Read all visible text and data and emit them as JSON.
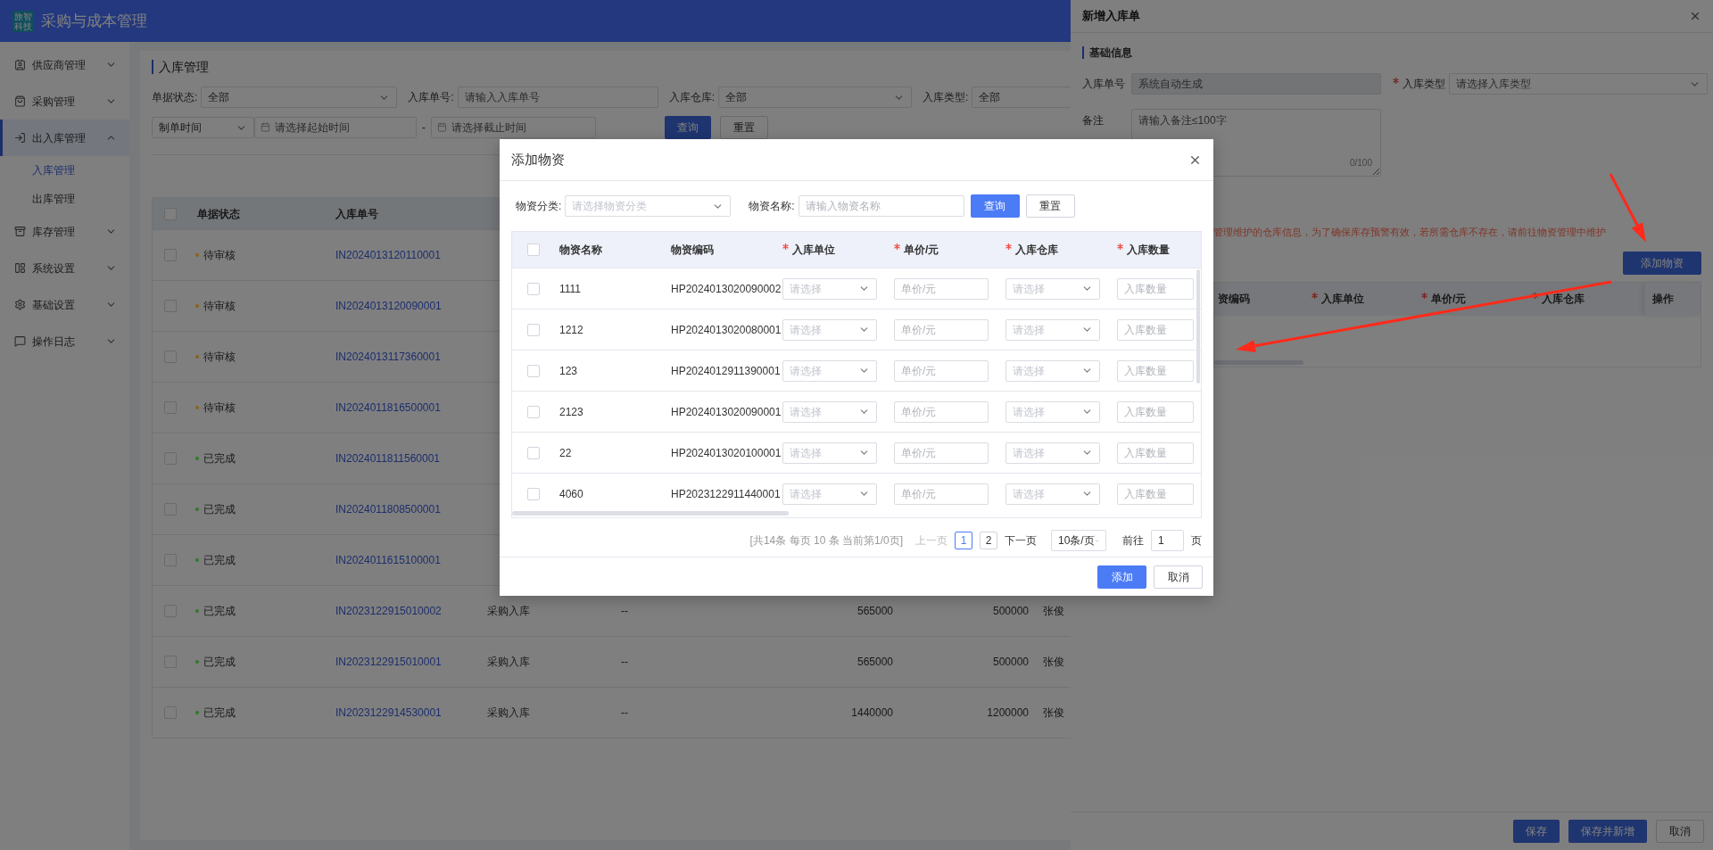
{
  "app": {
    "logo_text": "旅智科技",
    "title": "采购与成本管理"
  },
  "sidebar": {
    "items": [
      {
        "label": "供应商管理",
        "selected": false,
        "expanded": false
      },
      {
        "label": "采购管理",
        "selected": false,
        "expanded": false
      },
      {
        "label": "出入库管理",
        "selected": true,
        "expanded": true,
        "children": [
          {
            "label": "入库管理",
            "selected": true
          },
          {
            "label": "出库管理",
            "selected": false
          }
        ]
      },
      {
        "label": "库存管理",
        "selected": false,
        "expanded": false
      },
      {
        "label": "系统设置",
        "selected": false,
        "expanded": false
      },
      {
        "label": "基础设置",
        "selected": false,
        "expanded": false
      },
      {
        "label": "操作日志",
        "selected": false,
        "expanded": false
      }
    ]
  },
  "page": {
    "title": "入库管理",
    "filters": [
      {
        "label": "单据状态:",
        "kind": "select",
        "value": "全部"
      },
      {
        "label": "入库单号:",
        "kind": "input",
        "placeholder": "请输入入库单号"
      },
      {
        "label": "入库仓库:",
        "kind": "select",
        "value": "全部"
      },
      {
        "label": "入库类型:",
        "kind": "select",
        "value": "全部"
      }
    ],
    "date_filter": {
      "field": "制单时间",
      "start_placeholder": "请选择起始时间",
      "separator": "-",
      "end_placeholder": "请选择截止时间"
    },
    "buttons": [
      {
        "label": "查询",
        "kind": "primary"
      },
      {
        "label": "重置",
        "kind": "default"
      }
    ],
    "table": {
      "all_checked": false,
      "columns": [
        "单据状态",
        "入库单号"
      ],
      "rows": [
        {
          "checked": false,
          "status": "待审核",
          "color": "#8a6418",
          "number": "IN2024013120110001"
        },
        {
          "checked": false,
          "status": "待审核",
          "color": "#8a6418",
          "number": "IN2024013120090001"
        },
        {
          "checked": false,
          "status": "待审核",
          "color": "#8a6418",
          "number": "IN2024013117360001"
        },
        {
          "checked": false,
          "status": "待审核",
          "color": "#8a6418",
          "number": "IN2024011816500001"
        },
        {
          "checked": false,
          "status": "已完成",
          "color": "#2f7a2a",
          "number": "IN2024011811560001"
        },
        {
          "checked": false,
          "status": "已完成",
          "color": "#2f7a2a",
          "number": "IN2024011808500001"
        },
        {
          "checked": false,
          "status": "已完成",
          "color": "#2f7a2a",
          "number": "IN2024011615100001"
        },
        {
          "checked": false,
          "status": "已完成",
          "color": "#2f7a2a",
          "number": "IN2023122915010002",
          "type": "采购入库",
          "remark": "--",
          "amount_1": "565000",
          "amount_2": "500000",
          "creator": "张俊"
        },
        {
          "checked": false,
          "status": "已完成",
          "color": "#2f7a2a",
          "number": "IN2023122915010001",
          "type": "采购入库",
          "remark": "--",
          "amount_1": "565000",
          "amount_2": "500000",
          "creator": "张俊"
        },
        {
          "checked": false,
          "status": "已完成",
          "color": "#2f7a2a",
          "number": "IN2023122914530001",
          "type": "采购入库",
          "remark": "--",
          "amount_1": "1440000",
          "amount_2": "1200000",
          "creator": "张俊"
        }
      ]
    }
  },
  "drawer": {
    "title": "新增入库单",
    "section": "基础信息",
    "fields": [
      {
        "label": "入库单号",
        "required": false,
        "kind": "input",
        "placeholder": "系统自动生成",
        "disabled": true
      },
      {
        "label": "入库类型",
        "required": true,
        "kind": "select",
        "placeholder": "请选择入库类型",
        "disabled": false
      }
    ],
    "remark": {
      "label": "备注",
      "placeholder": "请输入备注≤100字",
      "counter": "0/100"
    },
    "warning": "管理维护的仓库信息，为了确保库存预警有效，若所需仓库不存在，请前往物资管理中维护",
    "add_button": "添加物资",
    "columns": [
      {
        "label": "资编码",
        "required": false
      },
      {
        "label": "入库单位",
        "required": true
      },
      {
        "label": "单价/元",
        "required": true
      },
      {
        "label": "入库仓库",
        "required": true
      },
      {
        "label": "操作",
        "required": false
      }
    ],
    "footer_buttons": [
      {
        "label": "保存",
        "kind": "primary"
      },
      {
        "label": "保存并新增",
        "kind": "primary"
      },
      {
        "label": "取消",
        "kind": "default"
      }
    ]
  },
  "modal": {
    "title": "添加物资",
    "filters": [
      {
        "label": "物资分类:",
        "kind": "select",
        "placeholder": "请选择物资分类"
      },
      {
        "label": "物资名称:",
        "kind": "input",
        "placeholder": "请输入物资名称"
      }
    ],
    "buttons": [
      {
        "label": "查询",
        "kind": "primary"
      },
      {
        "label": "重置",
        "kind": "default"
      }
    ],
    "all_checked": false,
    "columns": [
      {
        "label": "物资名称",
        "required": false
      },
      {
        "label": "物资编码",
        "required": false
      },
      {
        "label": "入库单位",
        "required": true
      },
      {
        "label": "单价/元",
        "required": true
      },
      {
        "label": "入库仓库",
        "required": true
      },
      {
        "label": "入库数量",
        "required": true
      }
    ],
    "rows": [
      {
        "checked": false,
        "name": "1111",
        "code": "HP2024013020090002",
        "unit_placeholder": "请选择",
        "price_placeholder": "单价/元",
        "warehouse_placeholder": "请选择",
        "quantity_placeholder": "入库数量"
      },
      {
        "checked": false,
        "name": "1212",
        "code": "HP2024013020080001",
        "unit_placeholder": "请选择",
        "price_placeholder": "单价/元",
        "warehouse_placeholder": "请选择",
        "quantity_placeholder": "入库数量"
      },
      {
        "checked": false,
        "name": "123",
        "code": "HP2024012911390001",
        "unit_placeholder": "请选择",
        "price_placeholder": "单价/元",
        "warehouse_placeholder": "请选择",
        "quantity_placeholder": "入库数量"
      },
      {
        "checked": false,
        "name": "2123",
        "code": "HP2024013020090001",
        "unit_placeholder": "请选择",
        "price_placeholder": "单价/元",
        "warehouse_placeholder": "请选择",
        "quantity_placeholder": "入库数量"
      },
      {
        "checked": false,
        "name": "22",
        "code": "HP2024013020100001",
        "unit_placeholder": "请选择",
        "price_placeholder": "单价/元",
        "warehouse_placeholder": "请选择",
        "quantity_placeholder": "入库数量"
      },
      {
        "checked": false,
        "name": "4060",
        "code": "HP2023122911440001",
        "unit_placeholder": "请选择",
        "price_placeholder": "单价/元",
        "warehouse_placeholder": "请选择",
        "quantity_placeholder": "入库数量"
      }
    ],
    "pagination": {
      "summary": "[共14条 每页 10 条 当前第1/0页]",
      "prev": {
        "label": "上一页",
        "disabled": true
      },
      "pages": [
        {
          "label": "1",
          "selected": true
        },
        {
          "label": "2",
          "selected": false
        }
      ],
      "next": {
        "label": "下一页",
        "disabled": false
      },
      "page_size": "10条/页",
      "goto_label": "前往",
      "goto_value": "1",
      "goto_suffix": "页"
    },
    "footer_buttons": [
      {
        "label": "添加",
        "kind": "primary"
      },
      {
        "label": "取消",
        "kind": "default"
      }
    ]
  }
}
